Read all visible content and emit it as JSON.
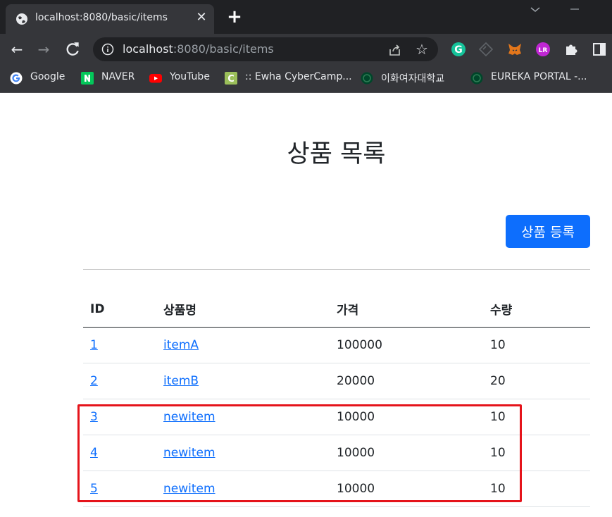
{
  "browser": {
    "tab_title": "localhost:8080/basic/items",
    "tab_close": "✕",
    "new_tab": "+",
    "url_host": "localhost",
    "url_rest": ":8080/basic/items",
    "bookmarks": [
      {
        "label": "Google"
      },
      {
        "label": "NAVER"
      },
      {
        "label": "YouTube"
      },
      {
        "label": ":: Ewha CyberCamp..."
      },
      {
        "label": "이화여자대학교"
      },
      {
        "label": "EUREKA PORTAL -..."
      }
    ]
  },
  "page": {
    "title": "상품 목록",
    "add_button": "상품 등록",
    "columns": [
      "ID",
      "상품명",
      "가격",
      "수량"
    ],
    "rows": [
      {
        "id": "1",
        "name": "itemA",
        "price": "100000",
        "quantity": "10"
      },
      {
        "id": "2",
        "name": "itemB",
        "price": "20000",
        "quantity": "20"
      },
      {
        "id": "3",
        "name": "newitem",
        "price": "10000",
        "quantity": "10"
      },
      {
        "id": "4",
        "name": "newitem",
        "price": "10000",
        "quantity": "10"
      },
      {
        "id": "5",
        "name": "newitem",
        "price": "10000",
        "quantity": "10"
      }
    ]
  },
  "colors": {
    "primary": "#0d6efd",
    "highlight": "#e5141b",
    "chrome_dark": "#202124",
    "chrome": "#35363a"
  }
}
